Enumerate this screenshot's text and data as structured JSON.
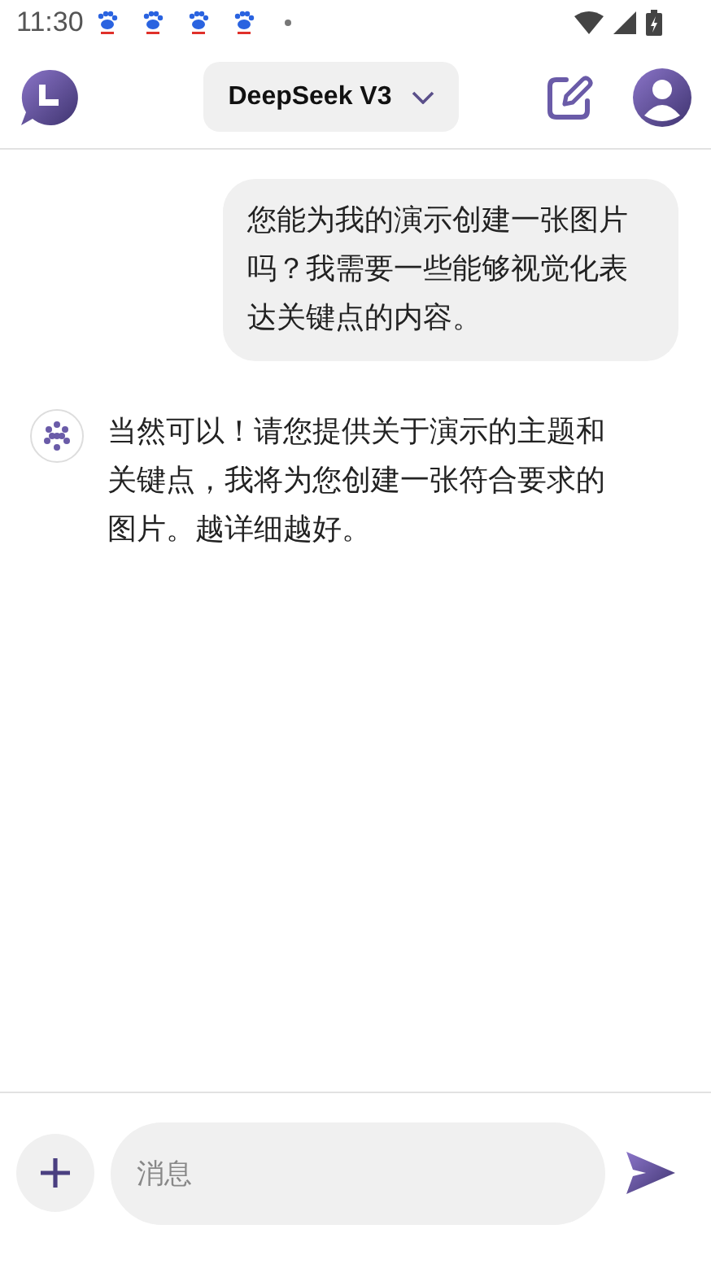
{
  "status_bar": {
    "time": "11:30"
  },
  "header": {
    "model": "DeepSeek V3"
  },
  "messages": [
    {
      "kind": "user",
      "text": "您能为我的演示创建一张图片吗？我需要一些能够视觉化表达关键点的内容。"
    },
    {
      "kind": "assistant",
      "text": "当然可以！请您提供关于演示的主题和关键点，我将为您创建一张符合要求的图片。越详细越好。"
    }
  ],
  "composer": {
    "placeholder": "消息"
  }
}
